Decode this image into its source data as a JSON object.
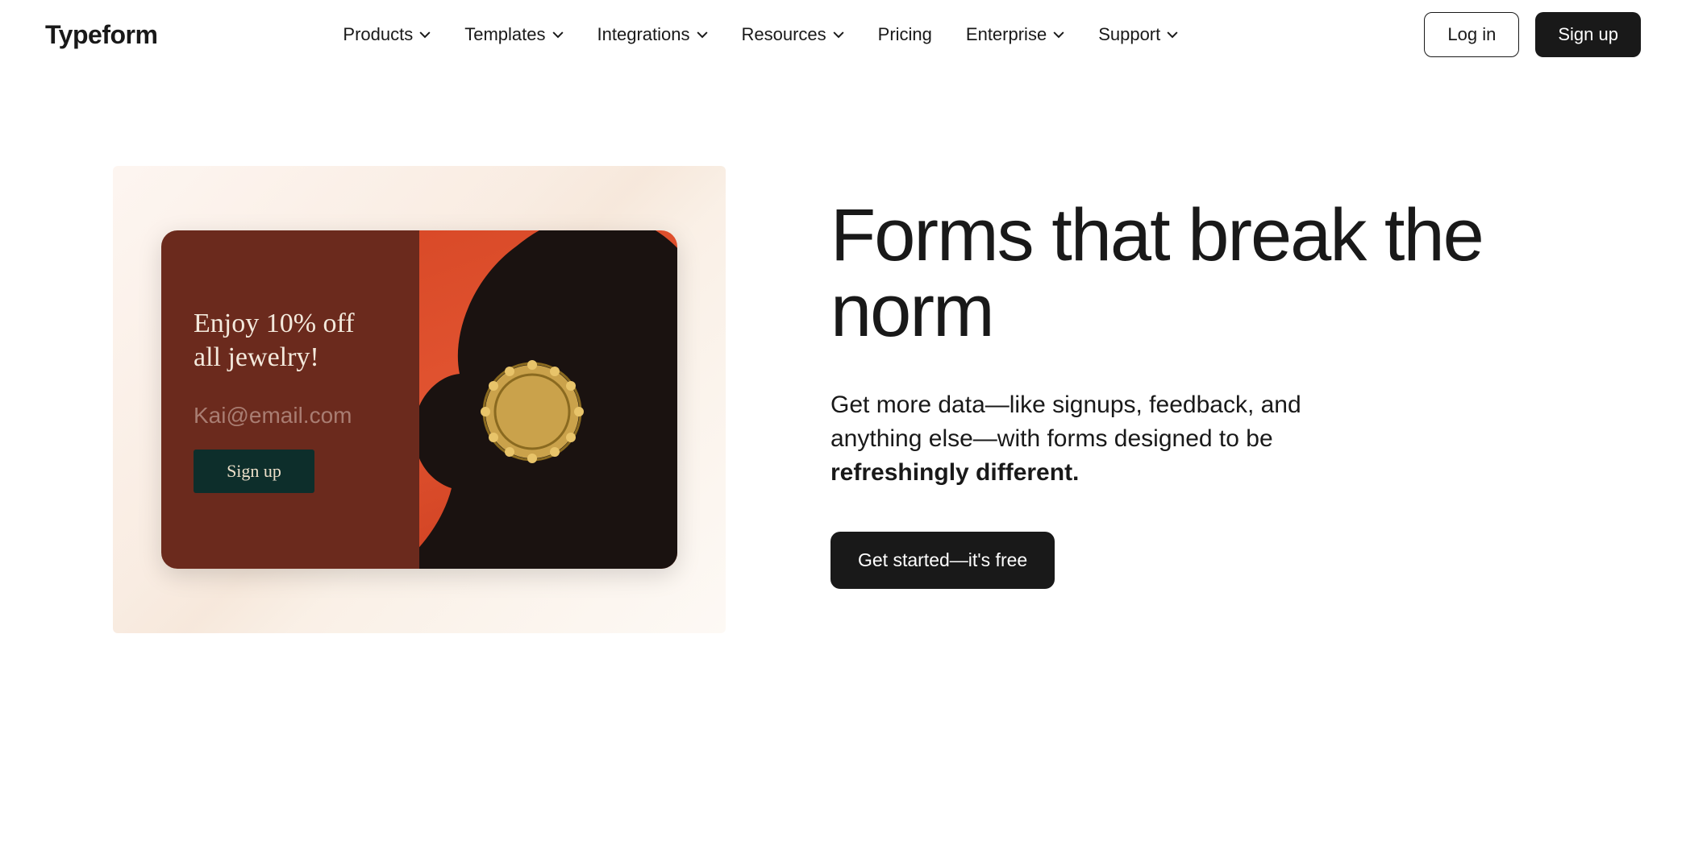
{
  "header": {
    "logo": "Typeform",
    "nav": [
      {
        "label": "Products",
        "dropdown": true
      },
      {
        "label": "Templates",
        "dropdown": true
      },
      {
        "label": "Integrations",
        "dropdown": true
      },
      {
        "label": "Resources",
        "dropdown": true
      },
      {
        "label": "Pricing",
        "dropdown": false
      },
      {
        "label": "Enterprise",
        "dropdown": true
      },
      {
        "label": "Support",
        "dropdown": true
      }
    ],
    "login_label": "Log in",
    "signup_label": "Sign up"
  },
  "card": {
    "title": "Enjoy 10% off all jewelry!",
    "email_placeholder": "Kai@email.com",
    "signup_label": "Sign up"
  },
  "hero": {
    "title": "Forms that break the norm",
    "subtitle_before": "Get more data—like signups, feedback, and anything else—with forms designed to be ",
    "subtitle_bold": "refreshingly different.",
    "cta_label": "Get started—it's free"
  }
}
